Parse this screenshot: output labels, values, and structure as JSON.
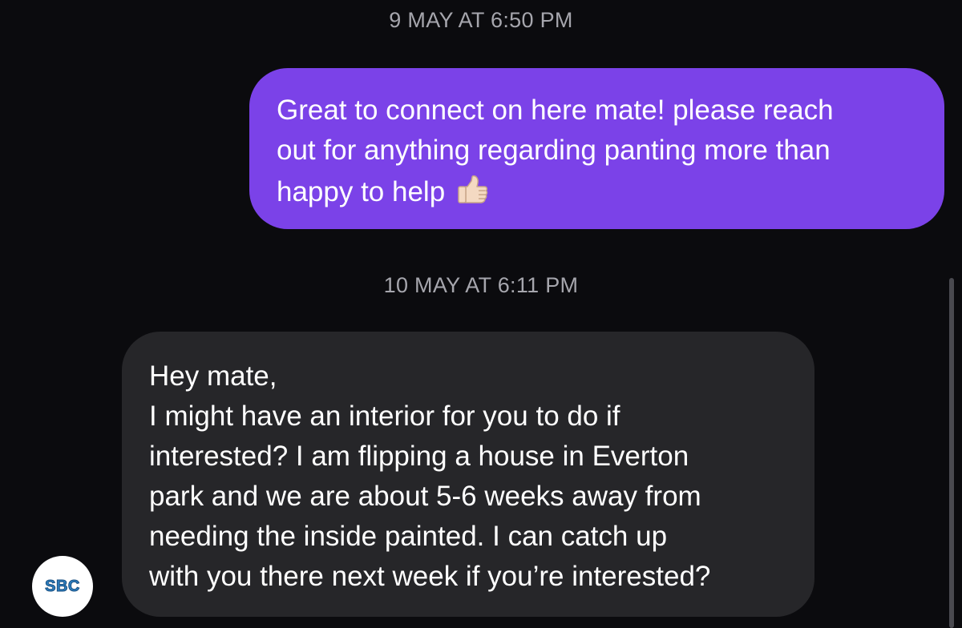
{
  "thread": {
    "timestamp_1": "9 MAY AT 6:50 PM",
    "timestamp_2": "10 MAY AT 6:11 PM"
  },
  "messages": {
    "outgoing": {
      "lines": [
        "Great to connect on here mate! please reach",
        "out for anything regarding panting more than",
        "happy to help"
      ],
      "emoji": "thumbs-up-icon"
    },
    "incoming": {
      "lines": [
        "Hey mate,",
        "I might have an interior for you to do if",
        "interested? I am flipping a house in Everton",
        "park and we are about 5-6 weeks away from",
        "needing the inside painted. I can catch up",
        "with you there next week if you’re interested?"
      ]
    }
  },
  "avatar": {
    "text": "SBC"
  },
  "colors": {
    "background": "#0b0b0e",
    "outgoing_bubble": "#7b42e8",
    "incoming_bubble": "#262629",
    "timestamp": "#a6a6ad"
  }
}
